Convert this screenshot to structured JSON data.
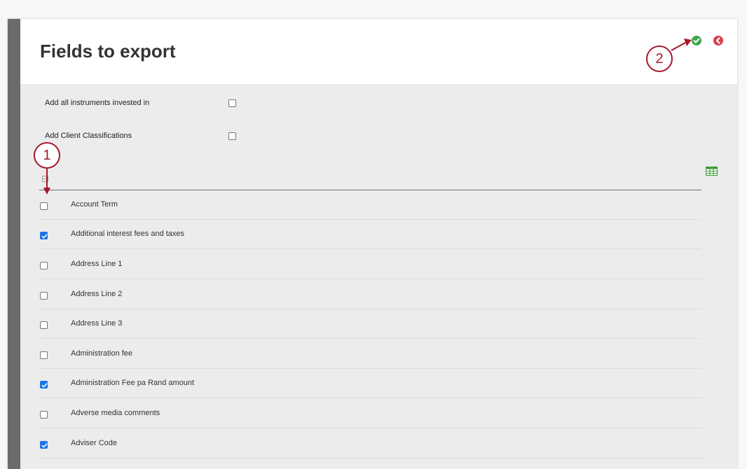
{
  "header": {
    "title": "Fields to export"
  },
  "actions": {
    "confirm_icon": "check-circle-icon",
    "back_icon": "chevron-left-circle-icon"
  },
  "options": [
    {
      "label": "Add all instruments invested in",
      "checked": false
    },
    {
      "label": "Add Client Classifications",
      "checked": false
    }
  ],
  "list_header": {
    "select_icon": "toggle-all-icon",
    "export_icon": "spreadsheet-icon"
  },
  "fields": [
    {
      "label": "Account Term",
      "checked": false
    },
    {
      "label": "Additional interest fees and taxes",
      "checked": true
    },
    {
      "label": "Address Line 1",
      "checked": false
    },
    {
      "label": "Address Line 2",
      "checked": false
    },
    {
      "label": "Address Line 3",
      "checked": false
    },
    {
      "label": "Administration fee",
      "checked": false
    },
    {
      "label": "Administration Fee pa Rand amount",
      "checked": true
    },
    {
      "label": "Adverse media comments",
      "checked": false
    },
    {
      "label": "Adviser Code",
      "checked": true
    }
  ],
  "annotations": [
    {
      "label": "1"
    },
    {
      "label": "2"
    }
  ],
  "colors": {
    "accent": "#1a73e8",
    "confirm": "#3fa84a",
    "back": "#d64250",
    "callout": "#a8172a"
  }
}
